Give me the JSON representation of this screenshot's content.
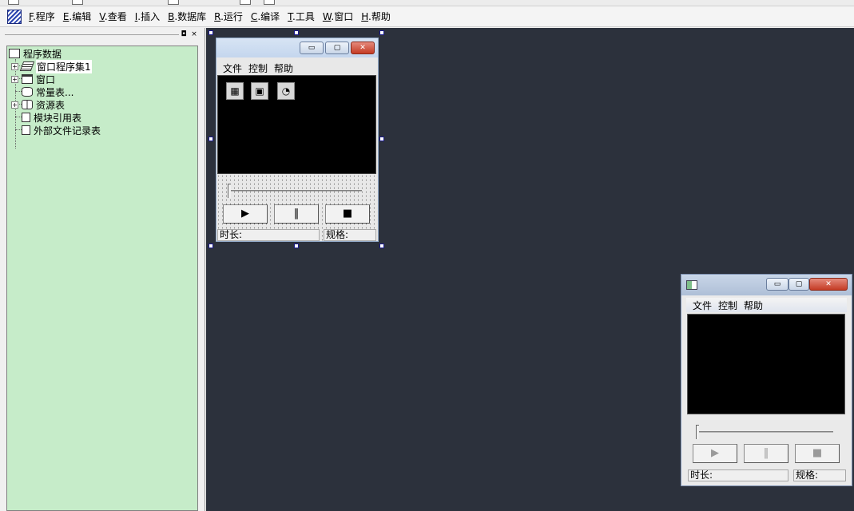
{
  "menubar": {
    "items": [
      {
        "key": "F",
        "label": ".程序"
      },
      {
        "key": "E",
        "label": ".编辑"
      },
      {
        "key": "V",
        "label": ".查看"
      },
      {
        "key": "I",
        "label": ".插入"
      },
      {
        "key": "B",
        "label": ".数据库"
      },
      {
        "key": "R",
        "label": ".运行"
      },
      {
        "key": "C",
        "label": ".编译"
      },
      {
        "key": "T",
        "label": ".工具"
      },
      {
        "key": "W",
        "label": ".窗口"
      },
      {
        "key": "H",
        "label": ".帮助"
      }
    ]
  },
  "panel": {
    "pin_glyph": "◘",
    "close_glyph": "×"
  },
  "tree": {
    "root": "程序数据",
    "items": [
      {
        "label": "窗口程序集1",
        "icon": "stack-icon",
        "expandable": true
      },
      {
        "label": "窗口",
        "icon": "window-icon",
        "expandable": true
      },
      {
        "label": "常量表...",
        "icon": "constant-icon",
        "expandable": false
      },
      {
        "label": "资源表",
        "icon": "resource-icon",
        "expandable": true
      },
      {
        "label": "模块引用表",
        "icon": "module-icon",
        "expandable": false
      },
      {
        "label": "外部文件记录表",
        "icon": "file-icon",
        "expandable": false
      }
    ]
  },
  "design_form": {
    "menu": [
      "文件",
      "控制",
      "帮助"
    ],
    "title_buttons": {
      "minimize": "▭",
      "maximize": "▢",
      "close": "✕"
    },
    "components": [
      {
        "icon": "calendar-component-icon",
        "glyph": "▦"
      },
      {
        "icon": "data-component-icon",
        "glyph": "▣"
      },
      {
        "icon": "timer-component-icon",
        "glyph": "◔"
      }
    ],
    "buttons": {
      "play": "▶",
      "pause": "‖",
      "stop": "■"
    },
    "slider_value": 0,
    "status": {
      "duration": "时长:",
      "spec": "规格:"
    }
  },
  "run_window": {
    "menu": [
      "文件",
      "控制",
      "帮助"
    ],
    "title_buttons": {
      "minimize": "▭",
      "maximize": "▢",
      "close": "✕"
    },
    "buttons": {
      "play": "▶",
      "pause": "‖",
      "stop": "■"
    },
    "slider_value": 0,
    "status": {
      "duration": "时长:",
      "spec": "规格:"
    }
  }
}
